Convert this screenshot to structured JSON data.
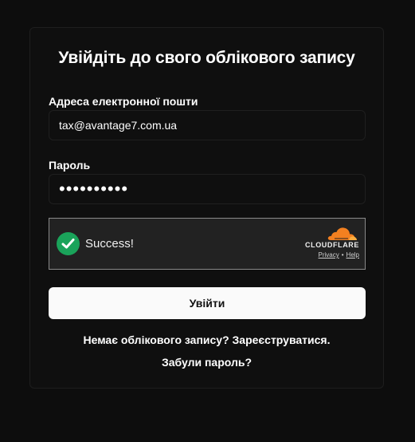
{
  "login": {
    "title": "Увійдіть до свого облікового запису",
    "email_label": "Адреса електронної пошти",
    "email_value": "tax@avantage7.com.ua",
    "password_label": "Пароль",
    "password_value": "••••••••••",
    "submit_label": "Увійти",
    "no_account_text": "Немає облікового запису?",
    "register_link": "Зареєструватися.",
    "forgot_link": "Забули пароль?"
  },
  "captcha": {
    "status": "Success!",
    "brand": "CLOUDFLARE",
    "privacy_link": "Privacy",
    "separator": "•",
    "help_link": "Help",
    "success_color": "#1aa35a",
    "brand_color": "#f38020"
  },
  "colors": {
    "background": "#0d0d0d",
    "button_bg": "#fafafa",
    "text": "#ffffff"
  }
}
